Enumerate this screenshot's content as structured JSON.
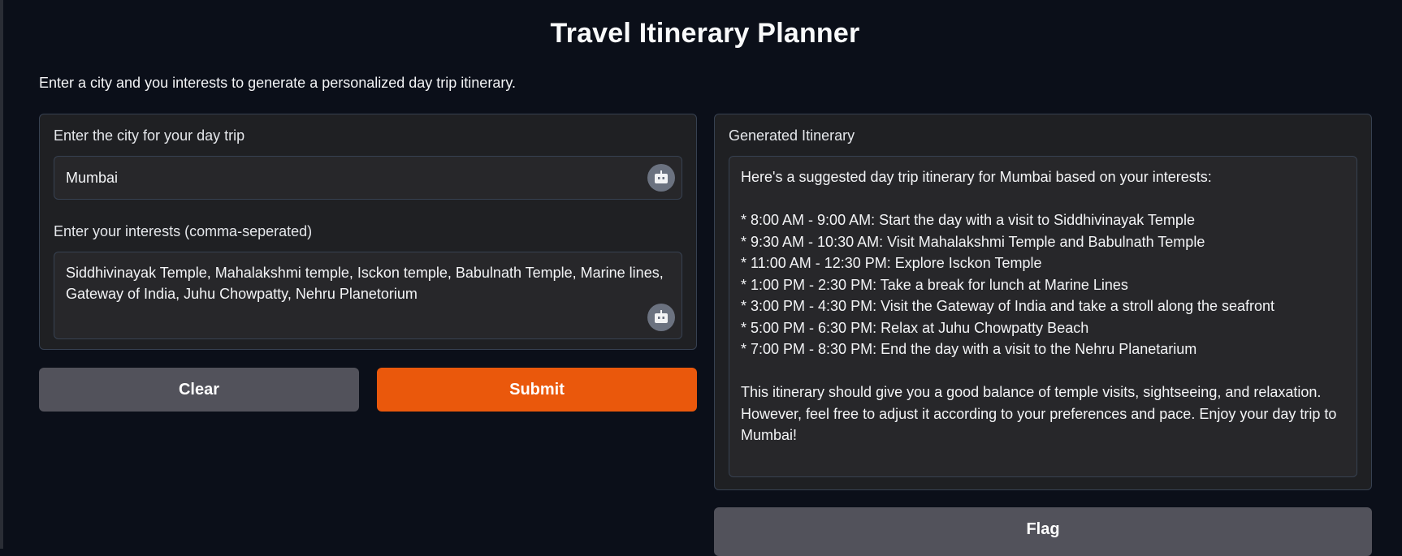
{
  "app": {
    "title": "Travel Itinerary Planner",
    "description": "Enter a city and you interests to generate a personalized day trip itinerary."
  },
  "inputs": {
    "city": {
      "label": "Enter the city for your day trip",
      "value": "Mumbai",
      "icon": "bot-icon"
    },
    "interests": {
      "label": "Enter your interests (comma-seperated)",
      "value": "Siddhivinayak Temple, Mahalakshmi temple, Isckon temple, Babulnath Temple, Marine lines, Gateway of India, Juhu Chowpatty, Nehru Planetorium",
      "icon": "bot-icon"
    }
  },
  "buttons": {
    "clear_label": "Clear",
    "submit_label": "Submit",
    "flag_label": "Flag"
  },
  "output": {
    "label": "Generated Itinerary",
    "intro": "Here's a suggested day trip itinerary for Mumbai based on your interests:",
    "items": [
      "* 8:00 AM - 9:00 AM: Start the day with a visit to Siddhivinayak Temple",
      "* 9:30 AM - 10:30 AM: Visit Mahalakshmi Temple and Babulnath Temple",
      "* 11:00 AM - 12:30 PM: Explore Isckon Temple",
      "* 1:00 PM - 2:30 PM: Take a break for lunch at Marine Lines",
      "* 3:00 PM - 4:30 PM: Visit the Gateway of India and take a stroll along the seafront",
      "* 5:00 PM - 6:30 PM: Relax at Juhu Chowpatty Beach",
      "* 7:00 PM - 8:30 PM: End the day with a visit to the Nehru Planetarium"
    ],
    "closing": "This itinerary should give you a good balance of temple visits, sightseeing, and relaxation. However, feel free to adjust it according to your preferences and pace. Enjoy your day trip to Mumbai!"
  },
  "colors": {
    "background": "#0b0f19",
    "panel": "#1f2023",
    "textbox": "#27272a",
    "primary_button": "#ea580c",
    "secondary_button": "#52525b"
  }
}
